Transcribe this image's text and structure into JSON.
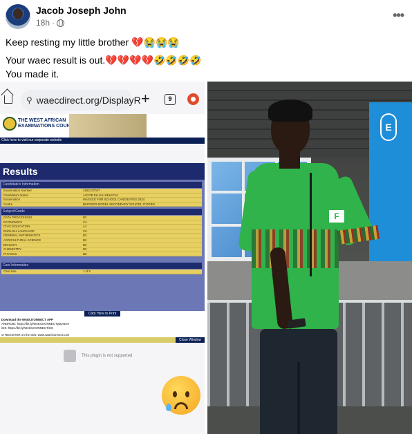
{
  "post": {
    "author_name": "Jacob Joseph John",
    "timestamp": "18h",
    "audience_icon": "globe-icon",
    "more_icon": "more-options-icon",
    "lines": [
      "Keep resting my little brother 💔😭😭😭",
      "Your waec result is out.💔💔💔💔🤣🤣🤣🤣",
      "You made it."
    ]
  },
  "screenshot": {
    "browser": {
      "url": "waecdirect.org/DisplayR",
      "tab_count": "9"
    },
    "waec": {
      "org_name_line1": "THE WEST AFRICAN",
      "org_name_line2": "EXAMINATIONS COUNCIL",
      "corporate_link": "Click here to visit our corporate website",
      "results_title": "Results",
      "candidate_section": "Candidate's Information",
      "candidate_rows": [
        {
          "label": "Examination Number",
          "value": "4152137047"
        },
        {
          "label": "Candidate's Name",
          "value": "JACOB ELIJAH KELECHI"
        },
        {
          "label": "Examination",
          "value": "WASSCE FOR SCHOOL CANDIDATES 2024"
        },
        {
          "label": "Centre",
          "value": "BLESSED MODEL SECONDARY SCHOOL OYIGBO"
        }
      ],
      "subject_section": "Subject/Grade",
      "subject_rows": [
        {
          "label": "DATA PROCESSING",
          "value": "B3"
        },
        {
          "label": "ECONOMICS",
          "value": "C4"
        },
        {
          "label": "CIVIC EDUCATION",
          "value": "A1"
        },
        {
          "label": "ENGLISH LANGUAGE",
          "value": "C6"
        },
        {
          "label": "GENERAL MATHEMATICS",
          "value": "B2"
        },
        {
          "label": "AGRICULTURAL SCIENCE",
          "value": "B2"
        },
        {
          "label": "BIOLOGY",
          "value": "B2"
        },
        {
          "label": "CHEMISTRY",
          "value": "B3"
        },
        {
          "label": "PHYSICS",
          "value": "B3"
        }
      ],
      "card_section": "Card Information",
      "card_rows": [
        {
          "label": "Card Use",
          "value": "1 of 5"
        }
      ],
      "print_button": "Click Here to Print",
      "download_lines": [
        "Download the WAECKONNECT APP",
        "ANDROID: https://bit.ly/WAECKONNECTplaystore",
        "iOS: https://bit.ly/WAECKONNECTiOS"
      ],
      "register_line": "or REGISTER on the web: www.waeckonnect.com",
      "close_button": "Close Window",
      "plugin_text": "This plugin is not supported"
    },
    "emoji": "sad-face-with-tear-icon"
  },
  "photo": {
    "shirt_badge": "F"
  }
}
